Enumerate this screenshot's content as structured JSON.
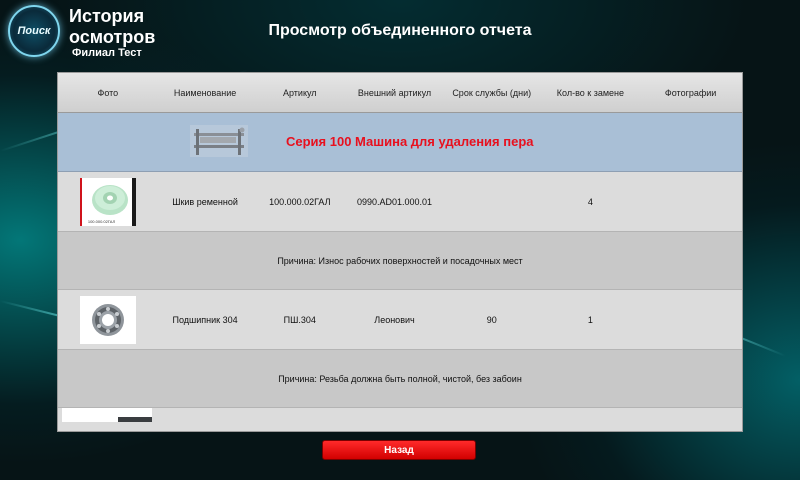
{
  "app": {
    "logo_text": "Поиск",
    "title": "История осмотров",
    "branch": "Филиал Тест",
    "page_title": "Просмотр объединенного отчета"
  },
  "table": {
    "columns": [
      "Фото",
      "Наименование",
      "Артикул",
      "Внешний артикул",
      "Срок службы (дни)",
      "Кол-во к замене",
      "Фотографии"
    ],
    "series_title": "Серия 100 Машина для удаления пера",
    "rows": [
      {
        "photo_icon": "pulley-photo",
        "photo_caption": "100.000.02ГАЛ",
        "name": "Шкив ременной",
        "article": "100.000.02ГАЛ",
        "external_article": "0990.AD01.000.01",
        "service_life": "",
        "replace_qty": "4",
        "reason": "Причина: Износ рабочих поверхностей и посадочных мест"
      },
      {
        "photo_icon": "bearing-photo",
        "name": "Подшипник 304",
        "article": "ПШ.304",
        "external_article": "Леонович",
        "service_life": "90",
        "replace_qty": "1",
        "reason": "Причина:  Резьба должна быть полной, чистой, без забоин"
      }
    ]
  },
  "buttons": {
    "back": "Назад"
  }
}
